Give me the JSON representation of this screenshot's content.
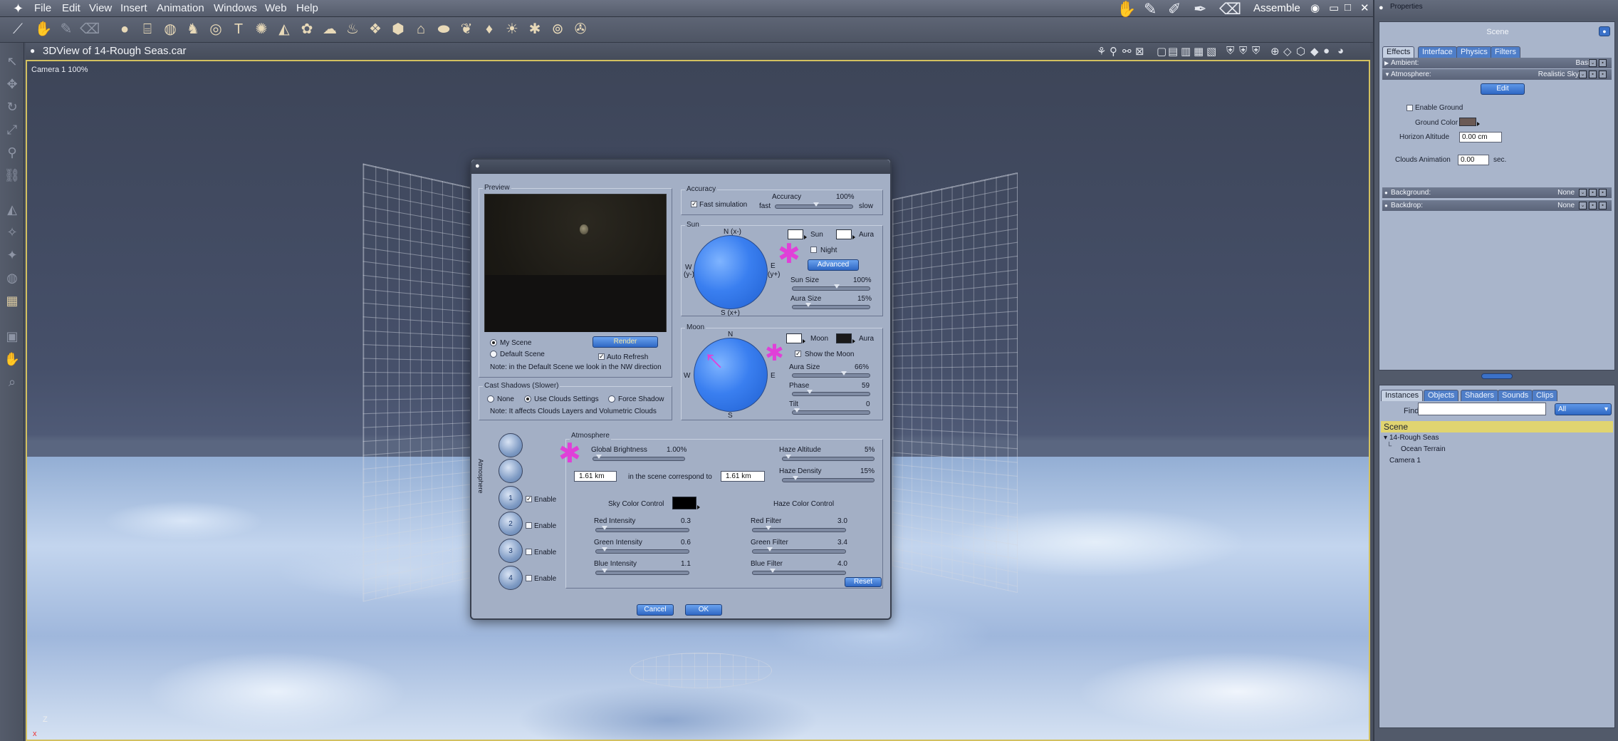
{
  "menubar": {
    "items": [
      "File",
      "Edit",
      "View",
      "Insert",
      "Animation",
      "Windows",
      "Web",
      "Help"
    ],
    "mode": "Assemble"
  },
  "view": {
    "title": "3DView of 14-Rough Seas.car",
    "camera_label": "Camera 1 100%"
  },
  "properties": {
    "title": "Properties",
    "scene_label": "Scene",
    "tabs": [
      "Effects",
      "Interface",
      "Physics",
      "Filters"
    ],
    "rows": {
      "ambient": {
        "label": "Ambient:",
        "value": "Basic"
      },
      "atmosphere": {
        "label": "Atmosphere:",
        "value": "Realistic Sky"
      },
      "background": {
        "label": "Background:",
        "value": "None"
      },
      "backdrop": {
        "label": "Backdrop:",
        "value": "None"
      }
    },
    "edit_label": "Edit",
    "enable_ground": "Enable Ground",
    "ground_color_label": "Ground Color",
    "horizon_altitude_label": "Horizon Altitude",
    "horizon_altitude_value": "0.00 cm",
    "clouds_animation_label": "Clouds Animation",
    "clouds_animation_value": "0.00",
    "clouds_animation_unit": "sec.",
    "ground_color": "#6b5a55"
  },
  "scene_tree": {
    "tabs": [
      "Instances",
      "Objects",
      "Shaders",
      "Sounds",
      "Clips"
    ],
    "find_label": "Find:",
    "filter_value": "All",
    "header": "Scene",
    "items": [
      "14-Rough Seas",
      "Ocean Terrain",
      "Camera 1"
    ]
  },
  "dialog": {
    "preview": {
      "label": "Preview",
      "my_scene": "My Scene",
      "default_scene": "Default Scene",
      "render": "Render",
      "auto_refresh": "Auto Refresh",
      "note": "Note: in the Default Scene we look in the NW direction"
    },
    "shadows": {
      "label": "Cast Shadows (Slower)",
      "none": "None",
      "use_clouds": "Use Clouds Settings",
      "force": "Force Shadow",
      "note": "Note: It affects Clouds Layers and Volumetric Clouds"
    },
    "accuracy": {
      "label": "Accuracy",
      "fast_sim": "Fast simulation",
      "accuracy_label": "Accuracy",
      "accuracy_value": "100%",
      "fast": "fast",
      "slow": "slow",
      "level": 0.5
    },
    "sun": {
      "label": "Sun",
      "n": "N (x-)",
      "w": "W",
      "wy": "(y-)",
      "e": "E",
      "ey": "(y+)",
      "s": "S (x+)",
      "sun_label": "Sun",
      "aura_label": "Aura",
      "night": "Night",
      "advanced": "Advanced",
      "sun_size_label": "Sun Size",
      "sun_size_value": "100%",
      "aura_size_label": "Aura Size",
      "aura_size_value": "15%"
    },
    "moon": {
      "label": "Moon",
      "n": "N",
      "w": "W",
      "e": "E",
      "s": "S",
      "moon_label": "Moon",
      "aura_label": "Aura",
      "show_moon": "Show the Moon",
      "aura_size_label": "Aura Size",
      "aura_size_value": "66%",
      "phase_label": "Phase",
      "phase_value": "59",
      "tilt_label": "Tilt",
      "tilt_value": "0"
    },
    "atmosphere": {
      "side_label": "Atmosphere",
      "label": "Atmosphere",
      "global_brightness_label": "Global Brightness",
      "global_brightness_value": "1.00%",
      "haze_altitude_label": "Haze Altitude",
      "haze_altitude_value": "5%",
      "haze_density_label": "Haze Density",
      "haze_density_value": "15%",
      "dist_a": "1.61 km",
      "dist_mid": "in the scene correspond to",
      "dist_b": "1.61 km",
      "sky_color_label": "Sky Color Control",
      "haze_color_label": "Haze Color Control",
      "red_intensity_label": "Red Intensity",
      "red_intensity_value": "0.3",
      "green_intensity_label": "Green Intensity",
      "green_intensity_value": "0.6",
      "blue_intensity_label": "Blue Intensity",
      "blue_intensity_value": "1.1",
      "red_filter_label": "Red Filter",
      "red_filter_value": "3.0",
      "green_filter_label": "Green Filter",
      "green_filter_value": "3.4",
      "blue_filter_label": "Blue Filter",
      "blue_filter_value": "4.0",
      "reset": "Reset",
      "enable": "Enable",
      "layer_numbers": [
        "1",
        "2",
        "3",
        "4"
      ]
    },
    "cancel": "Cancel",
    "ok": "OK"
  }
}
